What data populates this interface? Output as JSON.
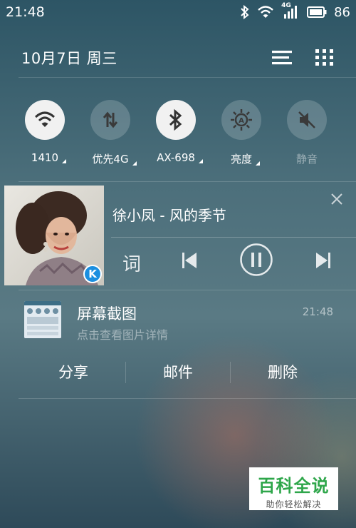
{
  "status_bar": {
    "time": "21:48",
    "network_type": "4G",
    "battery_percent": "86",
    "icons": [
      "bluetooth-icon",
      "wifi-icon",
      "cellular-signal-icon",
      "battery-icon"
    ]
  },
  "header": {
    "date": "10月7日  周三",
    "buttons": [
      "edit-list-icon",
      "grid-apps-icon"
    ]
  },
  "quick_toggles": [
    {
      "label": "1410",
      "icon": "wifi-icon",
      "state": "on",
      "has_menu": true
    },
    {
      "label": "优先4G",
      "icon": "data-arrows-icon",
      "state": "off",
      "has_menu": true
    },
    {
      "label": "AX-698",
      "icon": "bluetooth-icon",
      "state": "on",
      "has_menu": true
    },
    {
      "label": "亮度",
      "icon": "brightness-auto-icon",
      "state": "off",
      "has_menu": true
    },
    {
      "label": "静音",
      "icon": "mute-icon",
      "state": "off",
      "has_menu": false
    }
  ],
  "music": {
    "title": "徐小凤 - 风的季节",
    "lyrics_label": "词",
    "app_badge": "K"
  },
  "screenshot_notification": {
    "title": "屏幕截图",
    "subtitle": "点击查看图片详情",
    "time": "21:48",
    "actions": [
      "分享",
      "邮件",
      "删除"
    ]
  },
  "watermark": {
    "main": "百科全说",
    "sub": "助你轻松解决"
  },
  "colors": {
    "toggle_on": "#f1f1f1",
    "toggle_off": "rgba(255,255,255,0.18)",
    "logo_green": "#2ea64a",
    "app_badge_blue": "#1b8fe0"
  }
}
